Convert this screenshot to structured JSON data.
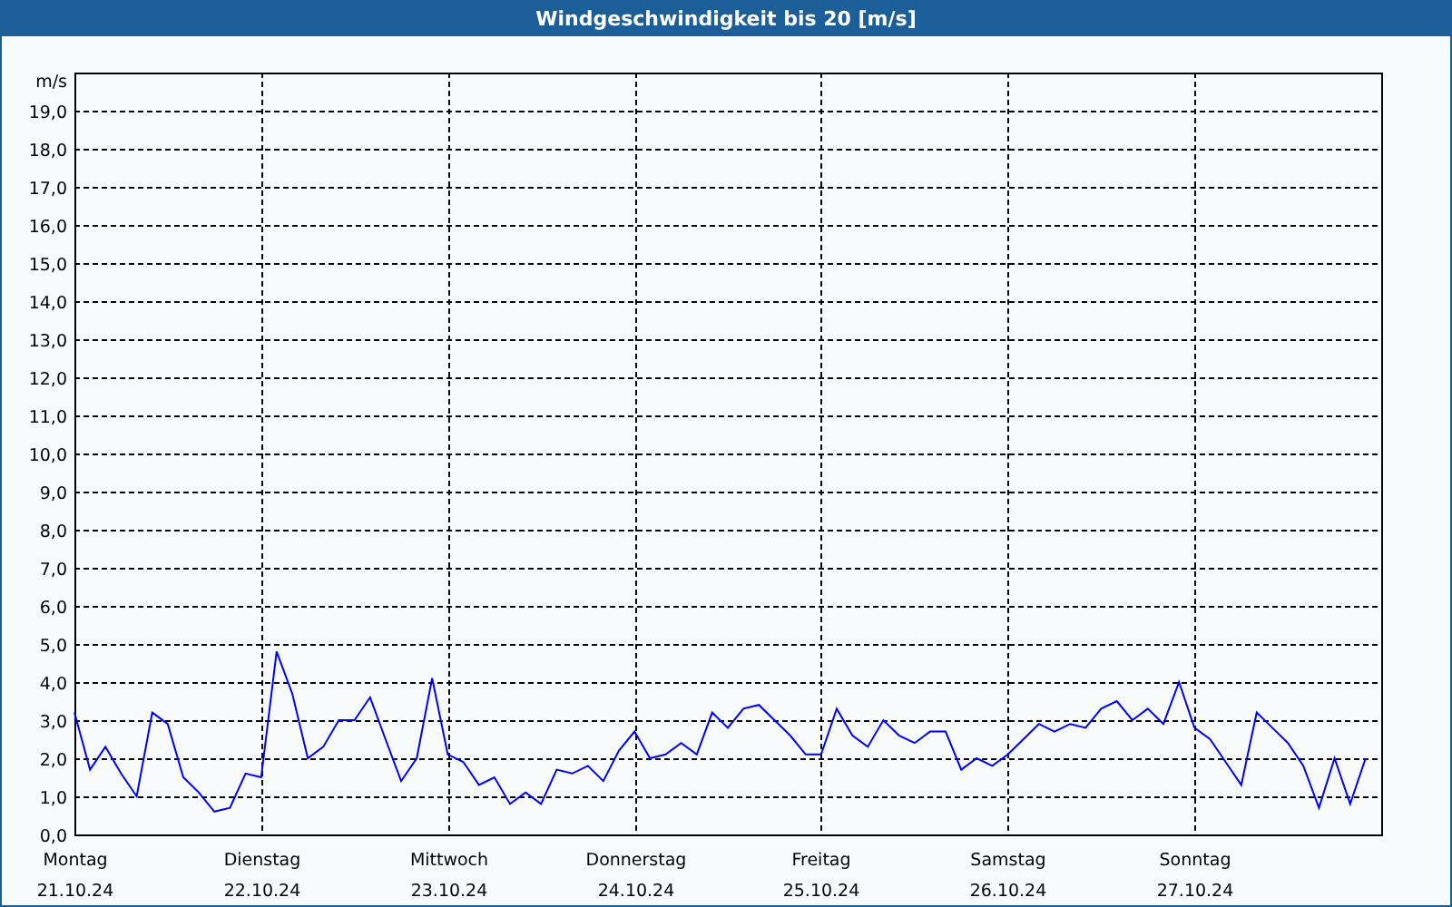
{
  "window": {
    "title": "Windgeschwindigkeit bis 20 [m/s]"
  },
  "chart": {
    "date_labels": [
      "21.10.24",
      "22.10.24",
      "23.10.24",
      "24.10.24",
      "25.10.24",
      "26.10.24",
      "27.10.24"
    ],
    "chart_data": {
      "type": "line",
      "grid": true,
      "ylabel": "m/s",
      "ylim": [
        0,
        20
      ],
      "categories": [
        "Montag",
        null,
        null,
        null,
        null,
        null,
        null,
        null,
        null,
        null,
        null,
        null,
        "Dienstag",
        null,
        null,
        null,
        null,
        null,
        null,
        null,
        null,
        null,
        null,
        null,
        "Mittwoch",
        null,
        null,
        null,
        null,
        null,
        null,
        null,
        null,
        null,
        null,
        null,
        "Donnerstag",
        null,
        null,
        null,
        null,
        null,
        null,
        null,
        null,
        null,
        null,
        null,
        "Freitag",
        null,
        null,
        null,
        null,
        null,
        null,
        null,
        null,
        null,
        null,
        null,
        "Samstag",
        null,
        null,
        null,
        null,
        null,
        null,
        null,
        null,
        null,
        null,
        null,
        "Sonntag",
        null,
        null,
        null,
        null,
        null,
        null,
        null,
        null,
        null,
        null,
        null
      ],
      "yticks": [
        {
          "value": 0,
          "label": "0,0"
        },
        {
          "value": 1,
          "label": "1,0"
        },
        {
          "value": 2,
          "label": "2,0"
        },
        {
          "value": 3,
          "label": "3,0"
        },
        {
          "value": 4,
          "label": "4,0"
        },
        {
          "value": 5,
          "label": "5,0"
        },
        {
          "value": 6,
          "label": "6,0"
        },
        {
          "value": 7,
          "label": "7,0"
        },
        {
          "value": 8,
          "label": "8,0"
        },
        {
          "value": 9,
          "label": "9,0"
        },
        {
          "value": 10,
          "label": "10,0"
        },
        {
          "value": 11,
          "label": "11,0"
        },
        {
          "value": 12,
          "label": "12,0"
        },
        {
          "value": 13,
          "label": "13,0"
        },
        {
          "value": 14,
          "label": "14,0"
        },
        {
          "value": 15,
          "label": "15,0"
        },
        {
          "value": 16,
          "label": "16,0"
        },
        {
          "value": 17,
          "label": "17,0"
        },
        {
          "value": 18,
          "label": "18,0"
        },
        {
          "value": 19,
          "label": "19,0"
        }
      ],
      "series": [
        {
          "color": "#0000ff",
          "values": [
            3.2,
            1.7,
            2.3,
            1.6,
            1.0,
            3.2,
            2.9,
            1.5,
            1.1,
            0.6,
            0.7,
            1.6,
            1.5,
            4.8,
            3.7,
            2.0,
            2.3,
            3.0,
            3.0,
            3.6,
            2.5,
            1.4,
            2.0,
            4.1,
            2.1,
            1.9,
            1.3,
            1.5,
            0.8,
            1.1,
            0.8,
            1.7,
            1.6,
            1.8,
            1.4,
            2.2,
            2.7,
            2.0,
            2.1,
            2.4,
            2.1,
            3.2,
            2.8,
            3.3,
            3.4,
            3.0,
            2.6,
            2.1,
            2.1,
            3.3,
            2.6,
            2.3,
            3.0,
            2.6,
            2.4,
            2.7,
            2.7,
            1.7,
            2.0,
            1.8,
            2.1,
            2.5,
            2.9,
            2.7,
            2.9,
            2.8,
            3.3,
            3.5,
            3.0,
            3.3,
            2.9,
            4.0,
            2.8,
            2.5,
            1.9,
            1.3,
            3.2,
            2.8,
            2.4,
            1.8,
            0.7,
            2.0,
            0.8,
            2.0
          ]
        }
      ]
    }
  }
}
